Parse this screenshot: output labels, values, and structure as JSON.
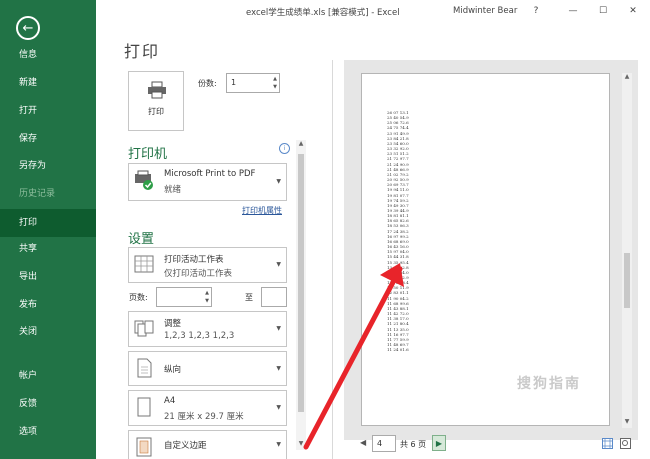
{
  "titlebar": {
    "title": "excel学生成绩单.xls  [兼容模式]  -  Excel",
    "user": "Midwinter Bear",
    "help": "?",
    "minimize": "—",
    "restore": "☐",
    "close": "✕"
  },
  "nav": {
    "back_glyph": "←",
    "items": [
      {
        "label": "信息"
      },
      {
        "label": "新建"
      },
      {
        "label": "打开"
      },
      {
        "label": "保存"
      },
      {
        "label": "另存为"
      },
      {
        "label": "历史记录"
      },
      {
        "label": "打印"
      },
      {
        "label": "共享"
      },
      {
        "label": "导出"
      },
      {
        "label": "发布"
      },
      {
        "label": "关闭"
      },
      {
        "label": "帐户"
      },
      {
        "label": "反馈"
      },
      {
        "label": "选项"
      }
    ]
  },
  "print": {
    "heading": "打印",
    "button_label": "打印",
    "copies_label": "份数:",
    "copies_value": "1"
  },
  "printer": {
    "section_title": "打印机",
    "info": "i",
    "name": "Microsoft Print to PDF",
    "status": "就绪",
    "properties_link": "打印机属性"
  },
  "settings": {
    "section_title": "设置",
    "scope_title": "打印活动工作表",
    "scope_sub": "仅打印活动工作表",
    "pages_label": "页数:",
    "to_label": "至",
    "collate_title": "调整",
    "collate_sub": "1,2,3    1,2,3    1,2,3",
    "orientation": "纵向",
    "paper_title": "A4",
    "paper_sub": "21 厘米 x 29.7 厘米",
    "margins": "自定义边距"
  },
  "preview": {
    "numbers": [
      "26 07 13.1",
      "25 40 54.9",
      "25 06 72.6",
      "24 75 74.4",
      "23 91 49.9",
      "23 84 21.8",
      "23 54 60.0",
      "23 32 92.0",
      "23 51 51.2",
      "21 72 97.7",
      "21 24 90.9",
      "21 48 66.9",
      "21 02 79.2",
      "20 92 50.9",
      "20 69 73.7",
      "19 94 11.0",
      "19 81 07.7",
      "19 74 59.2",
      "19 49 30.7",
      "19 39 44.9",
      "18 81 81.1",
      "18 65 82.6",
      "18 53 06.3",
      "17 24 38.2",
      "16 97 99.2",
      "16 68 69.0",
      "16 43 16.0",
      "15 97 04.0",
      "15 44 31.8",
      "15 35 95.4",
      "13 98 02.8",
      "13 45 64.0",
      "13 08 82.9",
      "12 78 88.4",
      "12 50 11.9",
      "12 83 01.1",
      "11 90 04.2",
      "11 68 99.6",
      "11 43 88.1",
      "11 42 72.0",
      "11 38 17.0",
      "11 21 80.4",
      "11 13 35.0",
      "11 16 97.7",
      "11 77 59.9",
      "11 48 69.7",
      "11 24 01.6"
    ],
    "page_current": "4",
    "page_total": "共 6 页",
    "watermark": "搜狗指南"
  }
}
